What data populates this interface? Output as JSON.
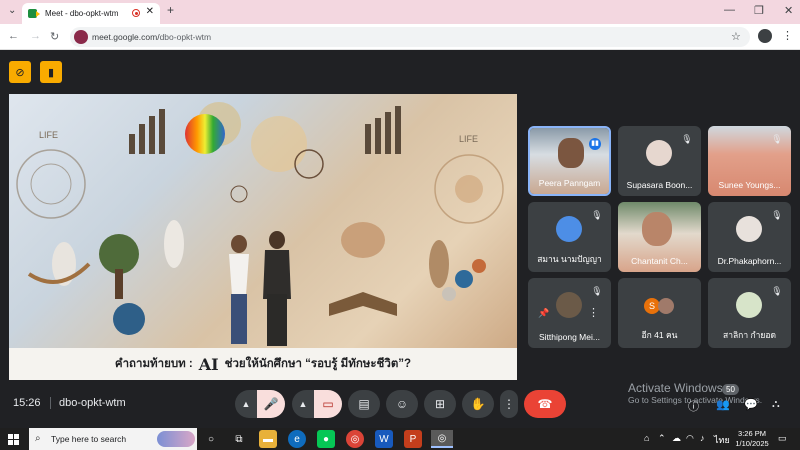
{
  "browser": {
    "tab_title": "Meet - dbo-opkt-wtm",
    "new_tab": "+",
    "address_host": "meet.google.com/",
    "address_path": "dbo-opkt-wtm"
  },
  "presentation": {
    "caption_question": "คำถามท้ายบท :",
    "caption_ai": "AI",
    "caption_rest": "ช่วยให้นักศึกษา “รอบรู้ มีทักษะชีวิต”?",
    "life_left": "LIFE",
    "life_right": "LIFE"
  },
  "participants": [
    {
      "name": "Peera Panngam",
      "muted": false,
      "speaking": true
    },
    {
      "name": "Supasara Boon...",
      "muted": true
    },
    {
      "name": "Sunee Youngs...",
      "muted": true
    },
    {
      "name": "สมาน นามปัญญา",
      "muted": true
    },
    {
      "name": "Chantanit Ch...",
      "muted": false
    },
    {
      "name": "Dr.Phakaphorn...",
      "muted": true
    },
    {
      "name": "Sitthipong Mei...",
      "muted": true
    },
    {
      "name": "อีก 41 คน",
      "muted": false
    },
    {
      "name": "สาลิกา กำยอด",
      "muted": true
    }
  ],
  "others_avatar_letter": "S",
  "bottom": {
    "time": "15:26",
    "meeting_code": "dbo-opkt-wtm",
    "people_badge": "50"
  },
  "watermark": {
    "line1": "Activate Windows",
    "line2": "Go to Settings to activate Windows."
  },
  "taskbar": {
    "search_placeholder": "Type here to search",
    "lang": "ไทย",
    "time": "3:26 PM",
    "date": "1/10/2025"
  },
  "colors": {
    "meet_bg": "#202124",
    "accent_yellow": "#f9ab00",
    "end_call_red": "#ea4335",
    "muted_pill": "#f9dedc",
    "tab_bar_pink": "#f3d7e0"
  }
}
